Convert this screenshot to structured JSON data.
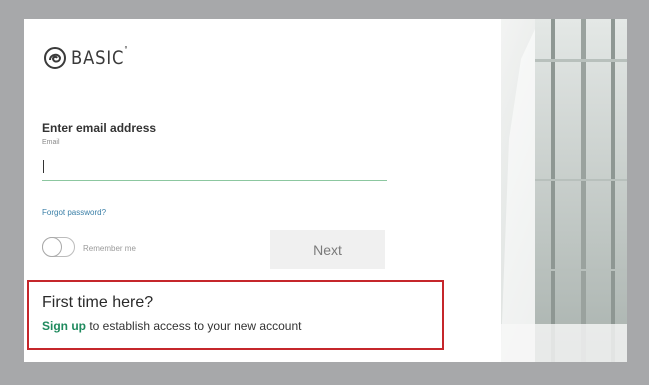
{
  "brand": {
    "name": "BASIC",
    "mark": "°",
    "logo_icon": "basic-swirl-logo-icon"
  },
  "login": {
    "heading": "Enter email address",
    "email_label": "Email",
    "email_value": "",
    "forgot_password": "Forgot password?",
    "remember_me": "Remember me",
    "next_button": "Next"
  },
  "first_time": {
    "title": "First time here?",
    "signup_link": "Sign up",
    "signup_rest": " to establish access to your new account"
  },
  "colors": {
    "frame_background": "#a7a8aa",
    "highlight_border": "#c5262b",
    "link_green": "#1f8a5e",
    "input_underline": "#8cc7a0",
    "forgot_link": "#3a7fa7"
  }
}
